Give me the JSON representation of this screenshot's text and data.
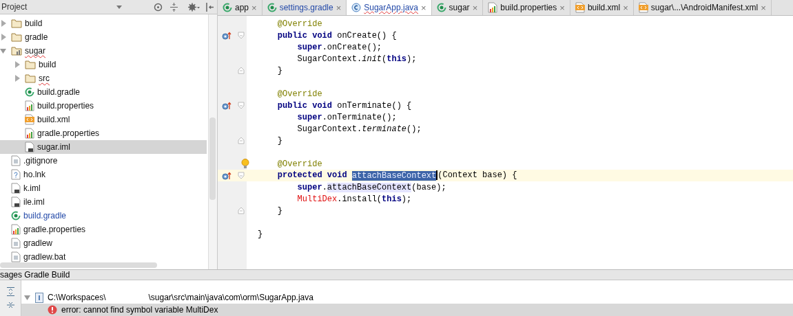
{
  "project_panel": {
    "title": "Project",
    "tree": [
      {
        "label": "build",
        "kind": "folder",
        "expanded": false,
        "selected": false,
        "misspelled": false,
        "modified": false
      },
      {
        "label": "gradle",
        "kind": "folder",
        "expanded": false,
        "selected": false,
        "misspelled": false,
        "modified": false
      },
      {
        "label": "sugar",
        "kind": "module",
        "expanded": true,
        "selected": false,
        "misspelled": true,
        "modified": false,
        "children": [
          {
            "label": "build",
            "kind": "folder",
            "expanded": false,
            "selected": false,
            "misspelled": false,
            "modified": false
          },
          {
            "label": "src",
            "kind": "folder",
            "expanded": false,
            "selected": false,
            "misspelled": true,
            "modified": false
          },
          {
            "label": "build.gradle",
            "kind": "gradle",
            "selected": false,
            "misspelled": false,
            "modified": false
          },
          {
            "label": "build.properties",
            "kind": "properties",
            "selected": false,
            "misspelled": false,
            "modified": false
          },
          {
            "label": "build.xml",
            "kind": "xml",
            "selected": false,
            "misspelled": false,
            "modified": false
          },
          {
            "label": "gradle.properties",
            "kind": "properties",
            "selected": false,
            "misspelled": false,
            "modified": false
          },
          {
            "label": "sugar.iml",
            "kind": "iml",
            "selected": true,
            "misspelled": false,
            "modified": false
          }
        ]
      },
      {
        "label": ".gitignore",
        "kind": "text",
        "selected": false,
        "misspelled": false,
        "modified": false
      },
      {
        "label": "ho.lnk",
        "kind": "unknown",
        "selected": false,
        "misspelled": false,
        "modified": false
      },
      {
        "label": "k.iml",
        "kind": "iml",
        "selected": false,
        "misspelled": false,
        "modified": false
      },
      {
        "label": "ile.iml",
        "kind": "iml",
        "selected": false,
        "misspelled": false,
        "modified": false
      },
      {
        "label": "build.gradle",
        "kind": "gradle",
        "selected": false,
        "misspelled": false,
        "modified": true
      },
      {
        "label": "gradle.properties",
        "kind": "properties",
        "selected": false,
        "misspelled": false,
        "modified": false
      },
      {
        "label": "gradlew",
        "kind": "text",
        "selected": false,
        "misspelled": false,
        "modified": false
      },
      {
        "label": "gradlew.bat",
        "kind": "text",
        "selected": false,
        "misspelled": false,
        "modified": false
      }
    ]
  },
  "editor_tabs": [
    {
      "label": "app",
      "kind": "gradle",
      "selected": false,
      "modified": false,
      "misspelled": false,
      "close": "×"
    },
    {
      "label": "settings.gradle",
      "kind": "gradle",
      "selected": false,
      "modified": true,
      "misspelled": false,
      "close": "×"
    },
    {
      "label": "SugarApp.java",
      "kind": "java",
      "selected": true,
      "modified": true,
      "misspelled": true,
      "close": "×"
    },
    {
      "label": "sugar",
      "kind": "gradle",
      "selected": false,
      "modified": false,
      "misspelled": false,
      "close": "×"
    },
    {
      "label": "build.properties",
      "kind": "properties",
      "selected": false,
      "modified": false,
      "misspelled": false,
      "close": "×"
    },
    {
      "label": "build.xml",
      "kind": "xml",
      "selected": false,
      "modified": false,
      "misspelled": false,
      "close": "×"
    },
    {
      "label": "sugar\\...\\AndroidManifest.xml",
      "kind": "xml",
      "selected": false,
      "modified": false,
      "misspelled": false,
      "close": "×"
    }
  ],
  "code": [
    {
      "override": false,
      "fold_start": false,
      "fold_end": false,
      "bulb": false,
      "current": false,
      "tokens": [
        {
          "text": "    @Override",
          "kind": "annotation"
        }
      ]
    },
    {
      "override": true,
      "fold_start": true,
      "fold_end": false,
      "bulb": false,
      "current": false,
      "tokens": [
        {
          "text": "    public void ",
          "kind": "keyword"
        },
        {
          "text": "onCreate() {",
          "kind": "plain"
        }
      ]
    },
    {
      "override": false,
      "fold_start": false,
      "fold_end": false,
      "bulb": false,
      "current": false,
      "tokens": [
        {
          "text": "        super",
          "kind": "keyword"
        },
        {
          "text": ".onCreate();",
          "kind": "plain"
        }
      ]
    },
    {
      "override": false,
      "fold_start": false,
      "fold_end": false,
      "bulb": false,
      "current": false,
      "tokens": [
        {
          "text": "        SugarContext.",
          "kind": "plain"
        },
        {
          "text": "init",
          "kind": "static"
        },
        {
          "text": "(",
          "kind": "plain"
        },
        {
          "text": "this",
          "kind": "keyword"
        },
        {
          "text": ");",
          "kind": "plain"
        }
      ]
    },
    {
      "override": false,
      "fold_start": false,
      "fold_end": true,
      "bulb": false,
      "current": false,
      "tokens": [
        {
          "text": "    }",
          "kind": "plain"
        }
      ]
    },
    {
      "override": false,
      "fold_start": false,
      "fold_end": false,
      "bulb": false,
      "current": false
    },
    {
      "override": false,
      "fold_start": false,
      "fold_end": false,
      "bulb": false,
      "current": false,
      "tokens": [
        {
          "text": "    @Override",
          "kind": "annotation"
        }
      ]
    },
    {
      "override": true,
      "fold_start": true,
      "fold_end": false,
      "bulb": false,
      "current": false,
      "tokens": [
        {
          "text": "    public void ",
          "kind": "keyword"
        },
        {
          "text": "onTerminate() {",
          "kind": "plain"
        }
      ]
    },
    {
      "override": false,
      "fold_start": false,
      "fold_end": false,
      "bulb": false,
      "current": false,
      "tokens": [
        {
          "text": "        super",
          "kind": "keyword"
        },
        {
          "text": ".onTerminate();",
          "kind": "plain"
        }
      ]
    },
    {
      "override": false,
      "fold_start": false,
      "fold_end": false,
      "bulb": false,
      "current": false,
      "tokens": [
        {
          "text": "        SugarContext.",
          "kind": "plain"
        },
        {
          "text": "terminate",
          "kind": "static"
        },
        {
          "text": "();",
          "kind": "plain"
        }
      ]
    },
    {
      "override": false,
      "fold_start": false,
      "fold_end": true,
      "bulb": false,
      "current": false,
      "tokens": [
        {
          "text": "    }",
          "kind": "plain"
        }
      ]
    },
    {
      "override": false,
      "fold_start": false,
      "fold_end": false,
      "bulb": false,
      "current": false
    },
    {
      "override": false,
      "fold_start": false,
      "fold_end": false,
      "bulb": true,
      "current": false,
      "tokens": [
        {
          "text": "    @Override",
          "kind": "annotation"
        }
      ]
    },
    {
      "override": true,
      "fold_start": true,
      "fold_end": false,
      "bulb": false,
      "current": true,
      "tokens": [
        {
          "text": "    protected void ",
          "kind": "keyword"
        },
        {
          "text": "attachBaseContext",
          "kind": "selected"
        },
        {
          "text": "(Context base) {",
          "kind": "plain"
        }
      ]
    },
    {
      "override": false,
      "fold_start": false,
      "fold_end": false,
      "bulb": false,
      "current": false,
      "tokens": [
        {
          "text": "        super",
          "kind": "keyword"
        },
        {
          "text": ".",
          "kind": "plain"
        },
        {
          "text": "attachBaseContext",
          "kind": "usage"
        },
        {
          "text": "(base);",
          "kind": "plain"
        }
      ]
    },
    {
      "override": false,
      "fold_start": false,
      "fold_end": false,
      "bulb": false,
      "current": false,
      "tokens": [
        {
          "text": "        MultiDex",
          "kind": "error"
        },
        {
          "text": ".install(",
          "kind": "plain"
        },
        {
          "text": "this",
          "kind": "keyword"
        },
        {
          "text": ");",
          "kind": "plain"
        }
      ]
    },
    {
      "override": false,
      "fold_start": false,
      "fold_end": true,
      "bulb": false,
      "current": false,
      "tokens": [
        {
          "text": "    }",
          "kind": "plain"
        }
      ]
    },
    {
      "override": false,
      "fold_start": false,
      "fold_end": false,
      "bulb": false,
      "current": false
    },
    {
      "override": false,
      "fold_start": false,
      "fold_end": false,
      "bulb": false,
      "current": false,
      "tokens": [
        {
          "text": "}",
          "kind": "plain"
        }
      ]
    }
  ],
  "messages_panel": {
    "title": "sages Gradle Build",
    "rows": [
      {
        "kind": "file",
        "expanded": true,
        "selected": false,
        "parts": [
          "C:\\Workspaces\\",
          "\\sugar\\src\\main\\java\\com\\orm\\SugarApp.java"
        ]
      },
      {
        "kind": "error",
        "selected": true,
        "parts": [
          "error: cannot find symbol variable MultiDex"
        ]
      }
    ]
  }
}
